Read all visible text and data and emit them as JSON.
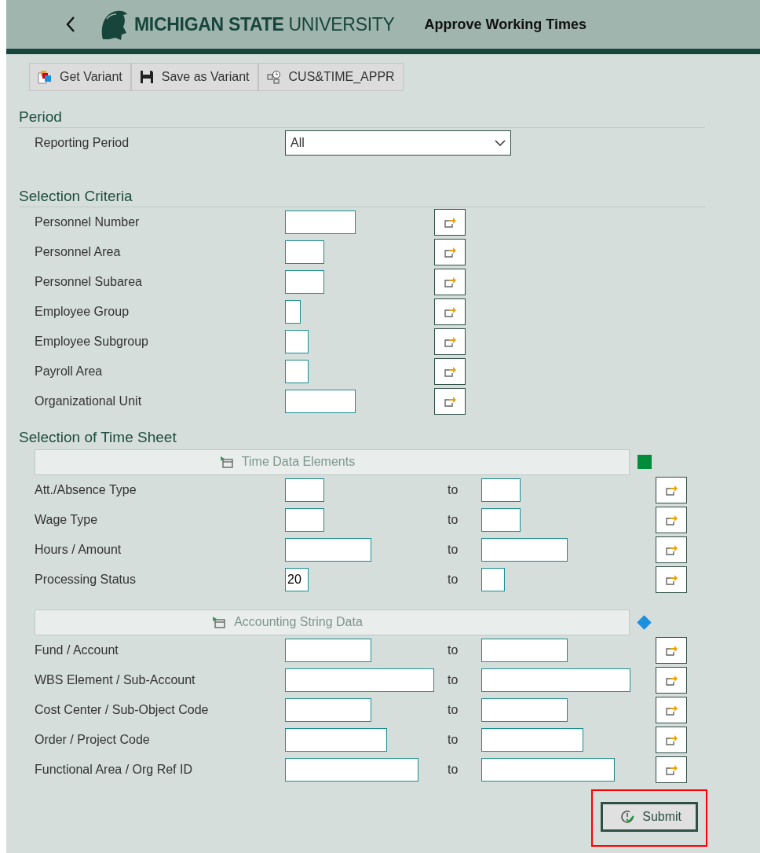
{
  "header": {
    "logo_bold": "MICHIGAN STATE",
    "logo_light": "UNIVERSITY",
    "title": "Approve Working Times"
  },
  "toolbar": [
    {
      "label": "Get Variant",
      "kind": "get"
    },
    {
      "label": "Save as Variant",
      "kind": "save"
    },
    {
      "label": "CUS&TIME_APPR",
      "kind": "program"
    }
  ],
  "period": {
    "heading": "Period",
    "field": {
      "label": "Reporting Period",
      "value": "All"
    }
  },
  "selection": {
    "heading": "Selection Criteria",
    "fields": [
      {
        "label": "Personnel Number"
      },
      {
        "label": "Personnel Area"
      },
      {
        "label": "Personnel Subarea"
      },
      {
        "label": "Employee Group"
      },
      {
        "label": "Employee Subgroup"
      },
      {
        "label": "Payroll Area"
      },
      {
        "label": "Organizational Unit"
      }
    ]
  },
  "timesheet": {
    "heading": "Selection of Time Sheet",
    "groups": [
      {
        "title": "Time Data Elements",
        "marker": {
          "kind": "square",
          "color": "#008c3a"
        },
        "rows": [
          {
            "label": "Att./Absence Type",
            "to_label": "to"
          },
          {
            "label": "Wage Type",
            "to_label": "to"
          },
          {
            "label": "Hours / Amount",
            "to_label": "to"
          },
          {
            "label": "Processing Status",
            "from": "20",
            "to_label": "to"
          }
        ]
      },
      {
        "title": "Accounting String Data",
        "marker": {
          "kind": "diamond",
          "color": "#1b8fe0"
        },
        "rows": [
          {
            "label": "Fund / Account",
            "to_label": "to"
          },
          {
            "label": "WBS Element / Sub-Account",
            "to_label": "to"
          },
          {
            "label": "Cost Center / Sub-Object Code",
            "to_label": "to"
          },
          {
            "label": "Order / Project Code",
            "to_label": "to"
          },
          {
            "label": "Functional Area / Org Ref ID",
            "to_label": "to"
          }
        ]
      }
    ]
  },
  "submit": {
    "label": "Submit",
    "highlighted": true
  }
}
